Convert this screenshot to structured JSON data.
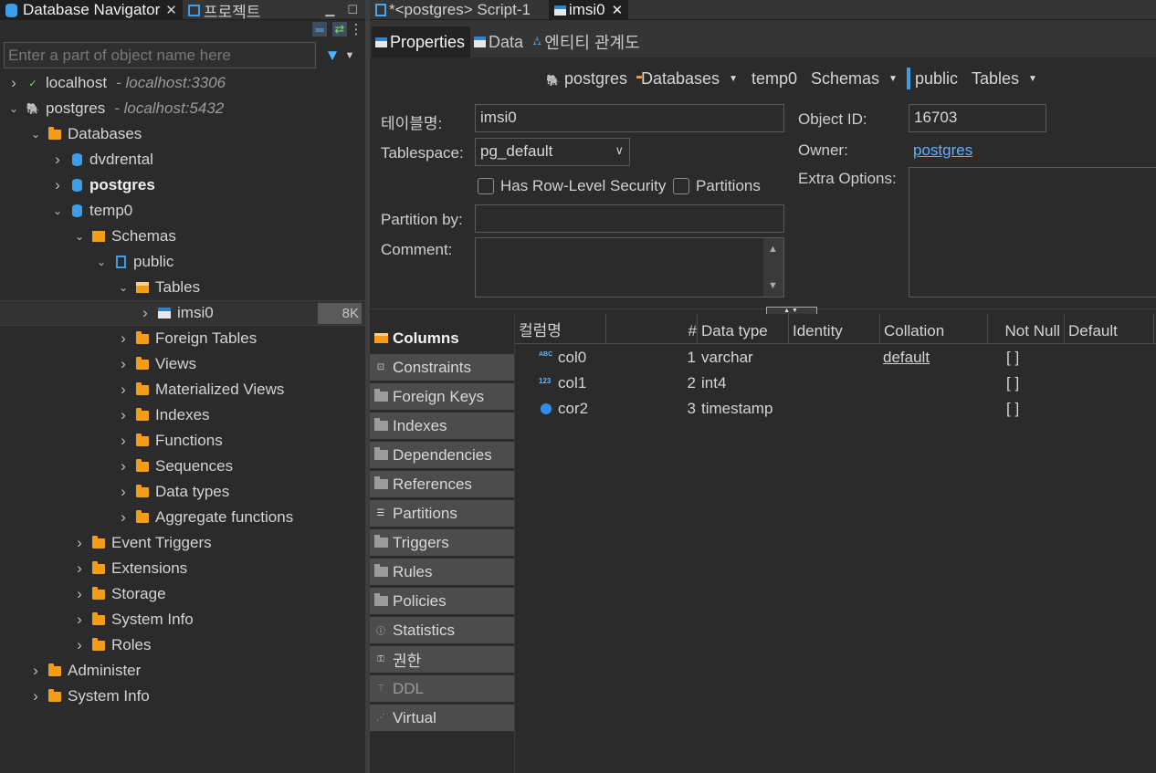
{
  "left_tabs": [
    {
      "label": "Database Navigator",
      "icon": "database-navigator-icon",
      "active": true
    },
    {
      "label": "프로젝트",
      "icon": "project-icon",
      "active": false
    }
  ],
  "filter": {
    "placeholder": "Enter a part of object name here"
  },
  "tree": [
    {
      "label": "localhost",
      "sub": "- localhost:3306",
      "depth": 0,
      "toggle": "collapsed",
      "icon": "mysql-connection-icon"
    },
    {
      "label": "postgres",
      "sub": "- localhost:5432",
      "depth": 0,
      "toggle": "expanded",
      "icon": "postgres-connection-icon"
    },
    {
      "label": "Databases",
      "depth": 1,
      "toggle": "expanded",
      "icon": "folder-icon"
    },
    {
      "label": "dvdrental",
      "depth": 2,
      "toggle": "collapsed",
      "icon": "database-icon"
    },
    {
      "label": "postgres",
      "depth": 2,
      "toggle": "collapsed",
      "icon": "database-icon",
      "bold": true
    },
    {
      "label": "temp0",
      "depth": 2,
      "toggle": "expanded",
      "icon": "database-icon"
    },
    {
      "label": "Schemas",
      "depth": 3,
      "toggle": "expanded",
      "icon": "schemas-icon"
    },
    {
      "label": "public",
      "depth": 4,
      "toggle": "expanded",
      "icon": "schema-icon"
    },
    {
      "label": "Tables",
      "depth": 5,
      "toggle": "expanded",
      "icon": "tables-icon"
    },
    {
      "label": "imsi0",
      "depth": 6,
      "toggle": "collapsed",
      "icon": "table-icon",
      "selected": true,
      "badge": "8K"
    },
    {
      "label": "Foreign Tables",
      "depth": 5,
      "toggle": "collapsed",
      "icon": "folder-icon"
    },
    {
      "label": "Views",
      "depth": 5,
      "toggle": "collapsed",
      "icon": "folder-icon"
    },
    {
      "label": "Materialized Views",
      "depth": 5,
      "toggle": "collapsed",
      "icon": "folder-icon"
    },
    {
      "label": "Indexes",
      "depth": 5,
      "toggle": "collapsed",
      "icon": "folder-icon"
    },
    {
      "label": "Functions",
      "depth": 5,
      "toggle": "collapsed",
      "icon": "folder-icon"
    },
    {
      "label": "Sequences",
      "depth": 5,
      "toggle": "collapsed",
      "icon": "folder-icon"
    },
    {
      "label": "Data types",
      "depth": 5,
      "toggle": "collapsed",
      "icon": "folder-icon"
    },
    {
      "label": "Aggregate functions",
      "depth": 5,
      "toggle": "collapsed",
      "icon": "folder-icon"
    },
    {
      "label": "Event Triggers",
      "depth": 3,
      "toggle": "collapsed",
      "icon": "folder-icon"
    },
    {
      "label": "Extensions",
      "depth": 3,
      "toggle": "collapsed",
      "icon": "extensions-icon"
    },
    {
      "label": "Storage",
      "depth": 3,
      "toggle": "collapsed",
      "icon": "info-folder-icon"
    },
    {
      "label": "System Info",
      "depth": 3,
      "toggle": "collapsed",
      "icon": "info-folder-icon"
    },
    {
      "label": "Roles",
      "depth": 3,
      "toggle": "collapsed",
      "icon": "info-folder-icon"
    },
    {
      "label": "Administer",
      "depth": 1,
      "toggle": "collapsed",
      "icon": "extensions-icon"
    },
    {
      "label": "System Info",
      "depth": 1,
      "toggle": "collapsed",
      "icon": "info-folder-icon"
    }
  ],
  "editor_tabs": [
    {
      "label": "*<postgres> Script-1",
      "icon": "sql-script-icon",
      "active": false
    },
    {
      "label": "imsi0",
      "icon": "table-icon",
      "active": true
    }
  ],
  "prop_tabs": [
    {
      "label": "Properties",
      "icon": "properties-icon",
      "active": true
    },
    {
      "label": "Data",
      "icon": "data-grid-icon",
      "active": false
    },
    {
      "label": "엔티티 관계도",
      "icon": "er-diagram-icon",
      "active": false
    }
  ],
  "breadcrumb": [
    {
      "label": "postgres",
      "icon": "postgres-connection-icon",
      "dropdown": false
    },
    {
      "label": "Databases",
      "icon": "folder-icon",
      "dropdown": true
    },
    {
      "label": "temp0",
      "icon": "database-icon",
      "dropdown": false
    },
    {
      "label": "Schemas",
      "icon": "schemas-icon",
      "dropdown": true
    },
    {
      "label": "public",
      "icon": "schema-icon",
      "dropdown": false
    },
    {
      "label": "Tables",
      "icon": "tables-icon",
      "dropdown": true
    }
  ],
  "form": {
    "table_name_label": "테이블명:",
    "table_name_value": "imsi0",
    "tablespace_label": "Tablespace:",
    "tablespace_value": "pg_default",
    "rls_label": "Has Row-Level Security",
    "partitions_label": "Partitions",
    "partition_by_label": "Partition by:",
    "partition_by_value": "",
    "comment_label": "Comment:",
    "object_id_label": "Object ID:",
    "object_id_value": "16703",
    "owner_label": "Owner:",
    "owner_value": "postgres",
    "extra_options_label": "Extra Options:"
  },
  "sub_tabs": [
    {
      "label": "Columns",
      "icon": "columns-icon",
      "active": true
    },
    {
      "label": "Constraints",
      "icon": "constraints-icon"
    },
    {
      "label": "Foreign Keys",
      "icon": "folder-icon"
    },
    {
      "label": "Indexes",
      "icon": "folder-icon"
    },
    {
      "label": "Dependencies",
      "icon": "folder-icon"
    },
    {
      "label": "References",
      "icon": "folder-icon"
    },
    {
      "label": "Partitions",
      "icon": "partitions-icon"
    },
    {
      "label": "Triggers",
      "icon": "folder-icon"
    },
    {
      "label": "Rules",
      "icon": "folder-icon"
    },
    {
      "label": "Policies",
      "icon": "folder-icon"
    },
    {
      "label": "Statistics",
      "icon": "statistics-icon"
    },
    {
      "label": "권한",
      "icon": "key-icon"
    },
    {
      "label": "DDL",
      "icon": "ddl-icon",
      "dim": true
    },
    {
      "label": "Virtual",
      "icon": "virtual-icon"
    }
  ],
  "columns_table": {
    "headers": [
      "컬럼명",
      "#",
      "Data type",
      "Identity",
      "Collation",
      "Not Null",
      "Default"
    ],
    "rows": [
      {
        "name": "col0",
        "num": "1",
        "type": "varchar",
        "identity": "",
        "collation": "default",
        "not_null": "[ ]",
        "default": "",
        "type_icon": "ABC"
      },
      {
        "name": "col1",
        "num": "2",
        "type": "int4",
        "identity": "",
        "collation": "",
        "not_null": "[ ]",
        "default": "",
        "type_icon": "123"
      },
      {
        "name": "cor2",
        "num": "3",
        "type": "timestamp",
        "identity": "",
        "collation": "",
        "not_null": "[ ]",
        "default": "",
        "type_icon": "clock"
      }
    ]
  },
  "colors": {
    "accent": "#3d9de6",
    "folder": "#f59c1a",
    "link": "#5bb2ff"
  }
}
